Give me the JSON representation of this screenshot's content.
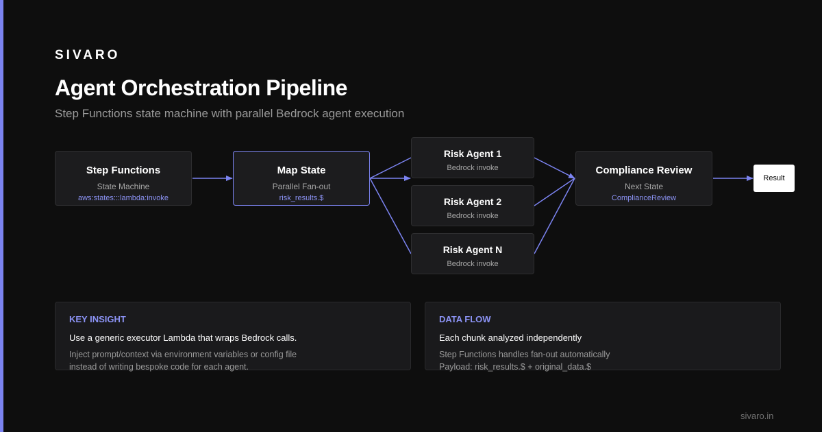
{
  "brand": "SIVARO",
  "title": "Agent Orchestration Pipeline",
  "subtitle": "Step Functions state machine with parallel Bedrock agent execution",
  "nodes": {
    "step_functions": {
      "title": "Step Functions",
      "subtitle": "State Machine",
      "code": "aws:states:::lambda:invoke"
    },
    "map_state": {
      "title": "Map State",
      "subtitle": "Parallel Fan-out",
      "code": "risk_results.$"
    },
    "agents": [
      {
        "title": "Risk Agent 1",
        "subtitle": "Bedrock invoke"
      },
      {
        "title": "Risk Agent 2",
        "subtitle": "Bedrock invoke"
      },
      {
        "title": "Risk Agent N",
        "subtitle": "Bedrock invoke"
      }
    ],
    "compliance": {
      "title": "Compliance Review",
      "subtitle": "Next State",
      "code": "ComplianceReview"
    },
    "result": "Result"
  },
  "cards": {
    "insight": {
      "heading": "KEY INSIGHT",
      "line1": "Use a generic executor Lambda that wraps Bedrock calls.",
      "line2": "Inject prompt/context via environment variables or config file",
      "line3": "instead of writing bespoke code for each agent."
    },
    "dataflow": {
      "heading": "DATA FLOW",
      "line1": "Each chunk analyzed independently",
      "line2": "Step Functions handles fan-out automatically",
      "line3": "Payload: risk_results.$ + original_data.$"
    }
  },
  "footer": "sivaro.in",
  "colors": {
    "accent": "#7b83f0",
    "background": "#0e0e0e",
    "node": "#1c1c1e"
  }
}
